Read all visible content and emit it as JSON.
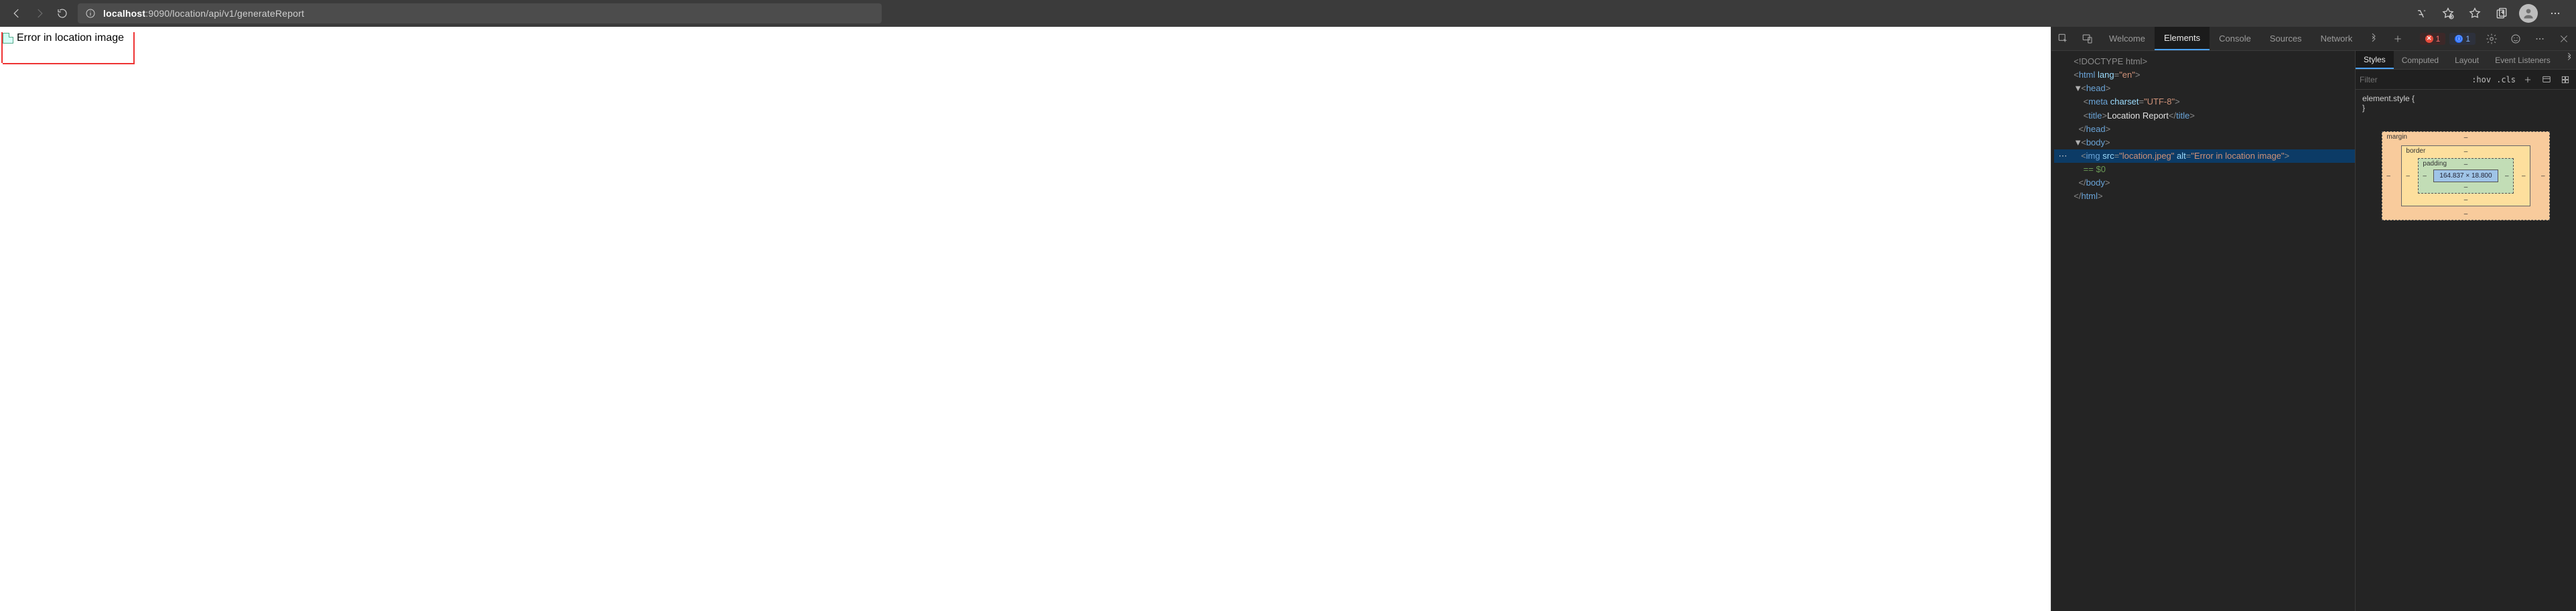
{
  "browser": {
    "url_host": "localhost",
    "url_rest": ":9090/location/api/v1/generateReport"
  },
  "page": {
    "broken_image_alt": "Error in location image"
  },
  "devtools": {
    "tabs": {
      "welcome": "Welcome",
      "elements": "Elements",
      "console": "Console",
      "sources": "Sources",
      "network": "Network"
    },
    "error_count": "1",
    "info_count": "1",
    "dom": {
      "doctype": "<!DOCTYPE html>",
      "html_open": "<html lang=\"en\">",
      "head_open": "<head>",
      "meta": "<meta charset=\"UTF-8\">",
      "title_open": "<title>",
      "title_text": "Location Report",
      "title_close": "</title>",
      "head_close": "</head>",
      "body_open": "<body>",
      "img": "<img src=\"location.jpeg\" alt=\"Error in location image\">",
      "eq0": "== $0",
      "body_close": "</body>",
      "html_close": "</html>"
    },
    "styles": {
      "tabs": {
        "styles": "Styles",
        "computed": "Computed",
        "layout": "Layout",
        "eventlisteners": "Event Listeners"
      },
      "filter_placeholder": "Filter",
      "hov": ":hov",
      "cls": ".cls",
      "element_style_open": "element.style {",
      "element_style_close": "}",
      "box": {
        "margin_label": "margin",
        "border_label": "border",
        "padding_label": "padding",
        "content_dims": "164.837 × 18.800",
        "dash": "–"
      }
    }
  }
}
